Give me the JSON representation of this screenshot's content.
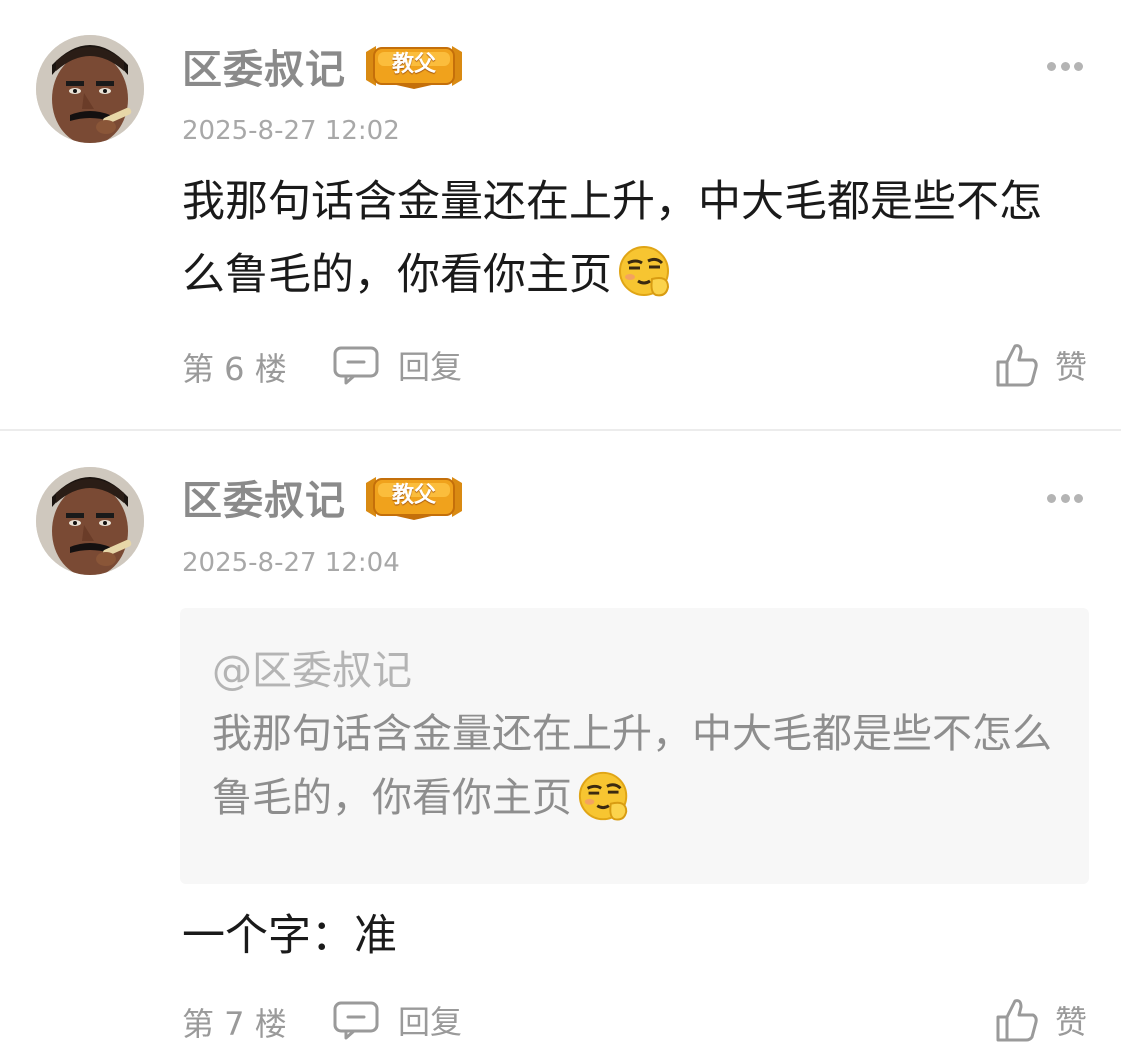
{
  "comments": [
    {
      "username": "区委叔记",
      "badge": "教父",
      "time": "2025-8-27 12:02",
      "content": "我那句话含金量还在上升，中大毛都是些不怎么鲁毛的，你看你主页",
      "emoji": "smirk-emoji",
      "floor": "第 6 楼",
      "reply_label": "回复",
      "like_label": "赞"
    },
    {
      "username": "区委叔记",
      "badge": "教父",
      "time": "2025-8-27 12:04",
      "quote_user": "@区委叔记",
      "quote_text": "我那句话含金量还在上升，中大毛都是些不怎么鲁毛的，你看你主页",
      "content": "一个字：准",
      "floor": "第 7 楼",
      "reply_label": "回复",
      "like_label": "赞"
    }
  ],
  "colors": {
    "username": "#8a8a8a",
    "time": "#a8a8a8",
    "badge_gold": "#e8a21c",
    "quote_bg": "#f7f7f7"
  }
}
